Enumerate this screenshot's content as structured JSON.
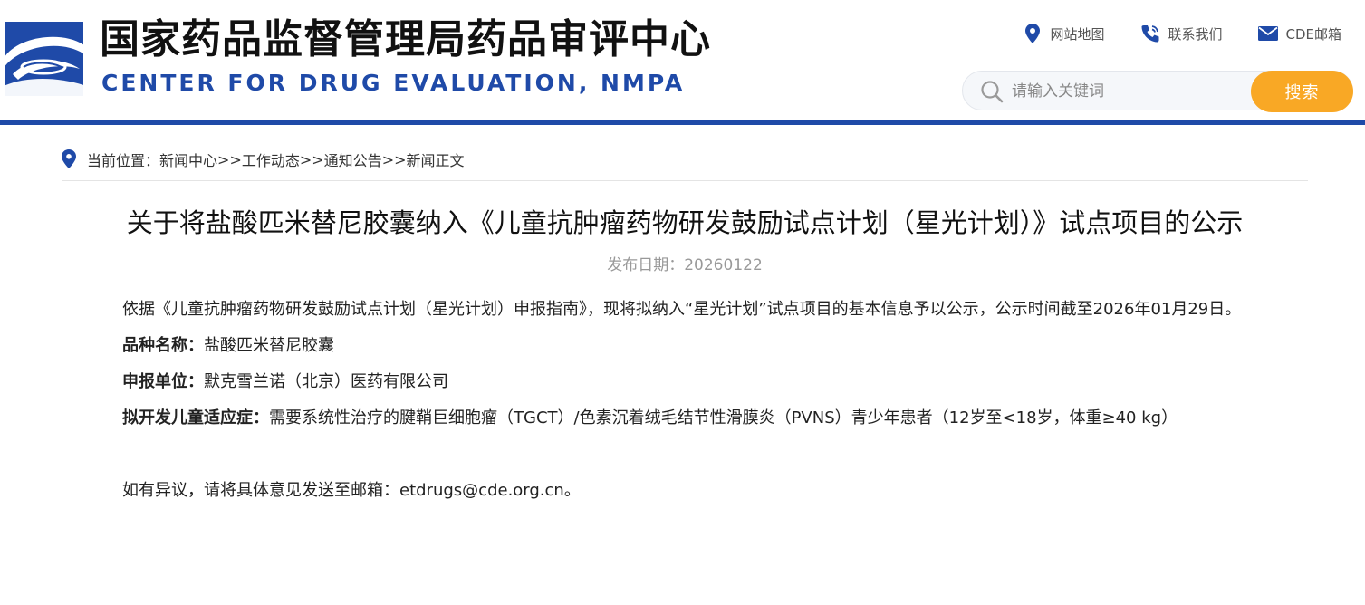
{
  "header": {
    "title_cn": "国家药品监督管理局药品审评中心",
    "title_en": "CENTER FOR DRUG EVALUATION, NMPA",
    "links": [
      {
        "label": "网站地图",
        "icon": "map-pin-icon"
      },
      {
        "label": "联系我们",
        "icon": "phone-icon"
      },
      {
        "label": "CDE邮箱",
        "icon": "mail-icon"
      }
    ],
    "search": {
      "placeholder": "请输入关键词",
      "value": "",
      "button_label": "搜索"
    },
    "colors": {
      "brand": "#1f4aa8",
      "search_button": "#f9a825"
    }
  },
  "breadcrumb": {
    "prefix": "当前位置：",
    "items": [
      "新闻中心",
      "工作动态",
      "通知公告",
      "新闻正文"
    ],
    "separator": ">>"
  },
  "article": {
    "title": "关于将盐酸匹米替尼胶囊纳入《儿童抗肿瘤药物研发鼓励试点计划（星光计划）》试点项目的公示",
    "publish_date": "发布日期：20260122",
    "intro": "依据《儿童抗肿瘤药物研发鼓励试点计划（星光计划）申报指南》，现将拟纳入“星光计划”试点项目的基本信息予以公示，公示时间截至2026年01月29日。",
    "fields": [
      {
        "label": "品种名称：",
        "value": "盐酸匹米替尼胶囊"
      },
      {
        "label": "申报单位：",
        "value": "默克雪兰诺（北京）医药有限公司"
      },
      {
        "label": "拟开发儿童适应症：",
        "value": "需要系统性治疗的腱鞘巨细胞瘤（TGCT）/色素沉着绒毛结节性滑膜炎（PVNS）青少年患者（12岁至<18岁，体重≥40 kg）"
      }
    ],
    "contact_prefix": "如有异议，请将具体意见发送至邮箱：",
    "contact_email": "etdrugs@cde.org.cn",
    "contact_suffix": "。"
  }
}
